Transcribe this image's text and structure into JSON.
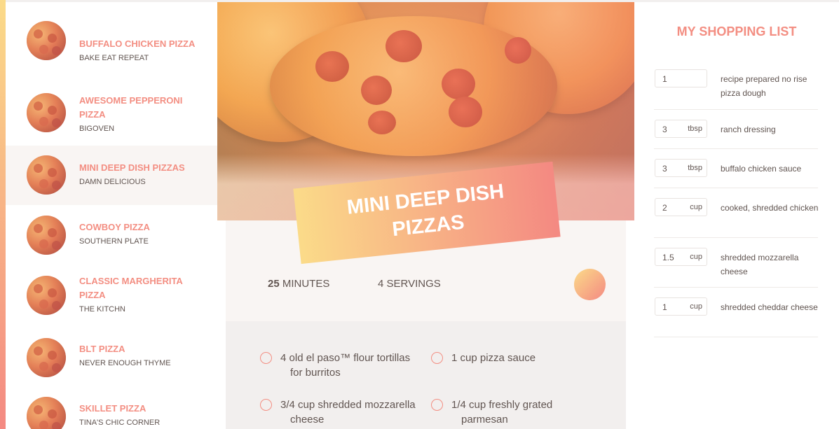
{
  "results": [
    {
      "title": "BUFFALO CHICKEN PIZZA",
      "publisher": "BAKE EAT REPEAT"
    },
    {
      "title": "AWESOME PEPPERONI PIZZA",
      "publisher": "BIGOVEN"
    },
    {
      "title": "MINI DEEP DISH PIZZAS",
      "publisher": "DAMN DELICIOUS"
    },
    {
      "title": "COWBOY PIZZA",
      "publisher": "SOUTHERN PLATE"
    },
    {
      "title": "CLASSIC MARGHERITA PIZZA",
      "publisher": "THE KITCHN"
    },
    {
      "title": "BLT PIZZA",
      "publisher": "NEVER ENOUGH THYME"
    },
    {
      "title": "SKILLET PIZZA",
      "publisher": "TINA'S CHIC CORNER"
    }
  ],
  "recipe": {
    "title": "MINI DEEP DISH PIZZAS",
    "minutes_value": "25",
    "minutes_label": "MINUTES",
    "servings_value": "4",
    "servings_label": "SERVINGS",
    "ingredients": [
      {
        "qty": "4",
        "text": "old el paso™ flour tortillas for burritos"
      },
      {
        "qty": "1",
        "text": "cup pizza sauce"
      },
      {
        "qty": "3/4",
        "text": "cup shredded mozzarella cheese"
      },
      {
        "qty": "1/4",
        "text": "cup freshly grated parmesan"
      }
    ]
  },
  "shopping_list": {
    "heading": "MY SHOPPING LIST",
    "items": [
      {
        "count": "1",
        "unit": "",
        "description": "recipe prepared no rise pizza dough"
      },
      {
        "count": "3",
        "unit": "tbsp",
        "description": "ranch dressing"
      },
      {
        "count": "3",
        "unit": "tbsp",
        "description": "buffalo chicken sauce"
      },
      {
        "count": "2",
        "unit": "cup",
        "description": "cooked, shredded chicken"
      },
      {
        "count": "1.5",
        "unit": "cup",
        "description": "shredded mozzarella cheese"
      },
      {
        "count": "1",
        "unit": "cup",
        "description": "shredded cheddar cheese"
      }
    ]
  },
  "colors": {
    "accent": "#f38e82",
    "gradient_start": "#fbdb89",
    "gradient_end": "#f48982",
    "active_bg": "#f9f5f3",
    "text": "#615551"
  }
}
